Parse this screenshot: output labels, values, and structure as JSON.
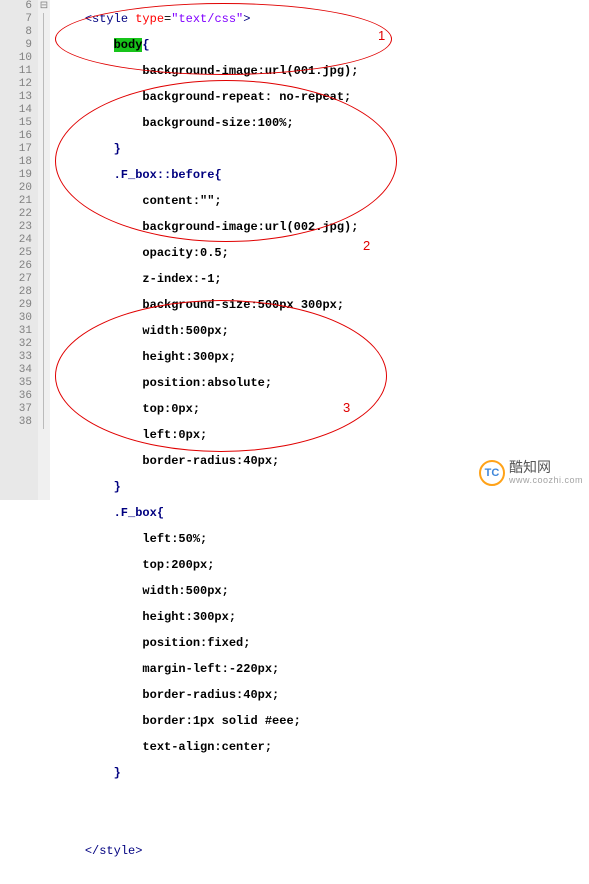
{
  "gutter": [
    "6",
    "7",
    "8",
    "9",
    "10",
    "11",
    "12",
    "13",
    "14",
    "15",
    "16",
    "17",
    "18",
    "19",
    "20",
    "21",
    "22",
    "23",
    "24",
    "25",
    "26",
    "27",
    "28",
    "29",
    "30",
    "31",
    "32",
    "33",
    "34",
    "35",
    "36",
    "37",
    "38"
  ],
  "code": {
    "l6_a": "<style",
    "l6_b": " type",
    "l6_c": "=",
    "l6_d": "\"text/css\"",
    "l6_e": ">",
    "l7_a": "body",
    "l7_b": "{",
    "l8": "background-image:url(001.jpg);",
    "l9": "background-repeat: no-repeat;",
    "l10": "background-size:100%;",
    "l11": "}",
    "l12_a": ".F_box::before",
    "l12_b": "{",
    "l13": "content:\"\";",
    "l14": "background-image:url(002.jpg);",
    "l15": "opacity:0.5;",
    "l16": "z-index:-1;",
    "l17": "background-size:500px 300px;",
    "l18": "width:500px;",
    "l19": "height:300px;",
    "l20": "position:absolute;",
    "l21": "top:0px;",
    "l22": "left:0px;",
    "l23": "border-radius:40px;",
    "l24": "}",
    "l25_a": ".F_box",
    "l25_b": "{",
    "l26": "left:50%;",
    "l27": "top:200px;",
    "l28": "width:500px;",
    "l29": "height:300px;",
    "l30": "position:fixed;",
    "l31": "margin-left:-220px;",
    "l32": "border-radius:40px;",
    "l33": "border:1px solid #eee;",
    "l34": "text-align:center;",
    "l35": "}",
    "l38": "</style>"
  },
  "labels": {
    "n1": "1",
    "n2": "2",
    "n3": "3"
  },
  "logo": {
    "icon": "TC",
    "name": "酷知网",
    "url": "www.coozhi.com"
  }
}
